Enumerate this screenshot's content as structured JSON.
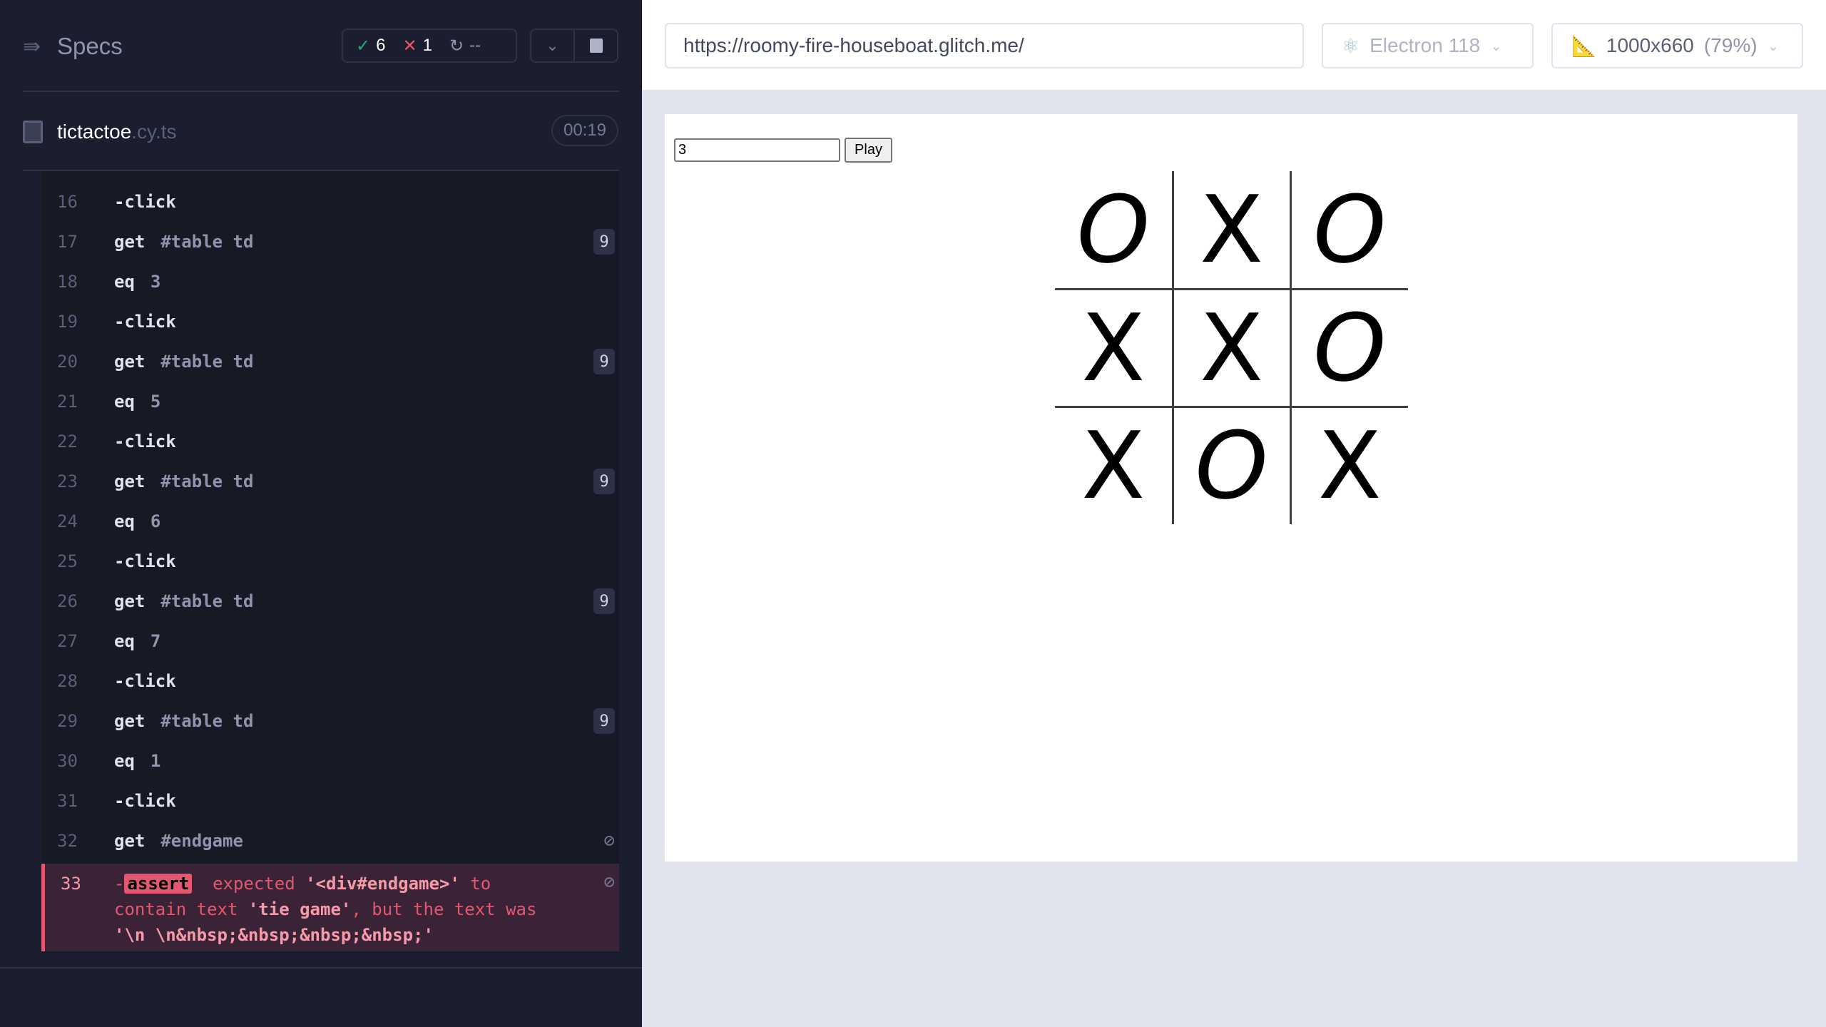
{
  "sidebar": {
    "title": "Specs",
    "stats": {
      "passed": "6",
      "failed": "1",
      "pending": "--"
    },
    "file": {
      "name": "tictactoe",
      "ext": ".cy.ts",
      "duration": "00:19"
    },
    "commands": [
      {
        "n": "16",
        "cmd": "-click",
        "arg": "",
        "badge": ""
      },
      {
        "n": "17",
        "cmd": "get",
        "arg": "#table td",
        "badge": "9"
      },
      {
        "n": "18",
        "cmd": "eq",
        "arg": "3",
        "badge": ""
      },
      {
        "n": "19",
        "cmd": "-click",
        "arg": "",
        "badge": ""
      },
      {
        "n": "20",
        "cmd": "get",
        "arg": "#table td",
        "badge": "9"
      },
      {
        "n": "21",
        "cmd": "eq",
        "arg": "5",
        "badge": ""
      },
      {
        "n": "22",
        "cmd": "-click",
        "arg": "",
        "badge": ""
      },
      {
        "n": "23",
        "cmd": "get",
        "arg": "#table td",
        "badge": "9"
      },
      {
        "n": "24",
        "cmd": "eq",
        "arg": "6",
        "badge": ""
      },
      {
        "n": "25",
        "cmd": "-click",
        "arg": "",
        "badge": ""
      },
      {
        "n": "26",
        "cmd": "get",
        "arg": "#table td",
        "badge": "9"
      },
      {
        "n": "27",
        "cmd": "eq",
        "arg": "7",
        "badge": ""
      },
      {
        "n": "28",
        "cmd": "-click",
        "arg": "",
        "badge": ""
      },
      {
        "n": "29",
        "cmd": "get",
        "arg": "#table td",
        "badge": "9"
      },
      {
        "n": "30",
        "cmd": "eq",
        "arg": "1",
        "badge": ""
      },
      {
        "n": "31",
        "cmd": "-click",
        "arg": "",
        "badge": ""
      },
      {
        "n": "32",
        "cmd": "get",
        "arg": "#endgame",
        "badge": "",
        "hidden_icon": "eye-slash-icon"
      }
    ],
    "failed": {
      "n": "33",
      "dash": "-",
      "cmd": "assert",
      "t1": "expected",
      "l1": "'<div#endgame>'",
      "t2": "to contain text",
      "l2": "'tie game'",
      "t3": ", but the text was",
      "l3": "'\\n \\n&nbsp;&nbsp;&nbsp;&nbsp;'"
    }
  },
  "topbar": {
    "url": "https://roomy-fire-houseboat.glitch.me/",
    "browser": "Electron 118",
    "viewport": "1000x660",
    "scale": "(79%)"
  },
  "app": {
    "input_value": "3",
    "play_label": "Play",
    "board": [
      [
        "O",
        "X",
        "O"
      ],
      [
        "X",
        "X",
        "O"
      ],
      [
        "X",
        "O",
        "X"
      ]
    ]
  },
  "colors": {
    "pass": "#1fa971",
    "fail": "#e45770",
    "sidebar_bg": "#1b1e2e"
  }
}
